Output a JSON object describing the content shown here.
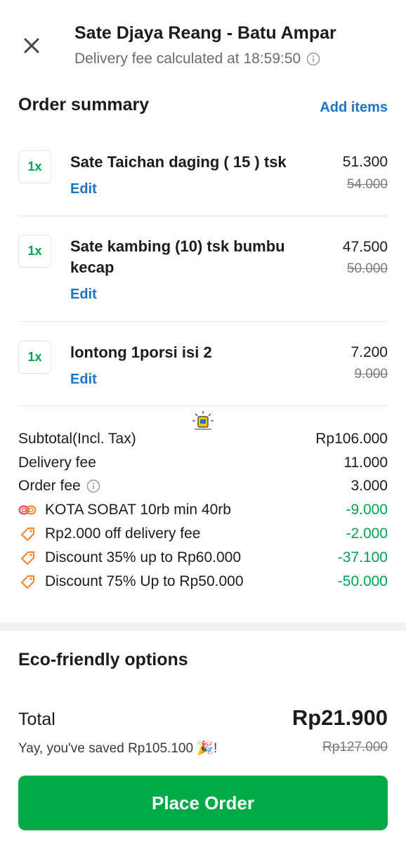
{
  "header": {
    "title": "Sate Djaya Reang - Batu Ampar",
    "subtitle": "Delivery fee calculated at 18:59:50"
  },
  "summary": {
    "title": "Order summary",
    "add_items": "Add items"
  },
  "items": [
    {
      "qty": "1x",
      "name": "Sate Taichan daging ( 15 ) tsk",
      "edit": "Edit",
      "price": "51.300",
      "old_price": "54.000"
    },
    {
      "qty": "1x",
      "name": "Sate kambing (10) tsk bumbu kecap",
      "edit": "Edit",
      "price": "47.500",
      "old_price": "50.000"
    },
    {
      "qty": "1x",
      "name": "lontong 1porsi isi 2",
      "edit": "Edit",
      "price": "7.200",
      "old_price": "9.000"
    }
  ],
  "fees": [
    {
      "label": "Subtotal(Incl. Tax)",
      "value": "Rp106.000"
    },
    {
      "label": "Delivery fee",
      "value": "11.000"
    },
    {
      "label": "Order fee",
      "value": "3.000"
    },
    {
      "label": "KOTA SOBAT 10rb min 40rb",
      "value": "-9.000",
      "icon": "loop-promo-icon"
    },
    {
      "label": "Rp2.000 off delivery fee",
      "value": "-2.000",
      "icon": "tag-icon"
    },
    {
      "label": "Discount 35% up to Rp60.000",
      "value": "-37.100",
      "icon": "tag-icon"
    },
    {
      "label": "Discount 75% Up to Rp50.000",
      "value": "-50.000",
      "icon": "tag-icon"
    }
  ],
  "eco": {
    "title": "Eco-friendly options"
  },
  "total": {
    "label": "Total",
    "value": "Rp21.900",
    "saved": "Yay, you've saved Rp105.100 🎉!",
    "old_value": "Rp127.000"
  },
  "place_order": "Place Order",
  "colors": {
    "green": "#00a351",
    "button_green": "#00aa46",
    "link_blue": "#1d73c6",
    "promo_orange": "#f08a3a"
  }
}
